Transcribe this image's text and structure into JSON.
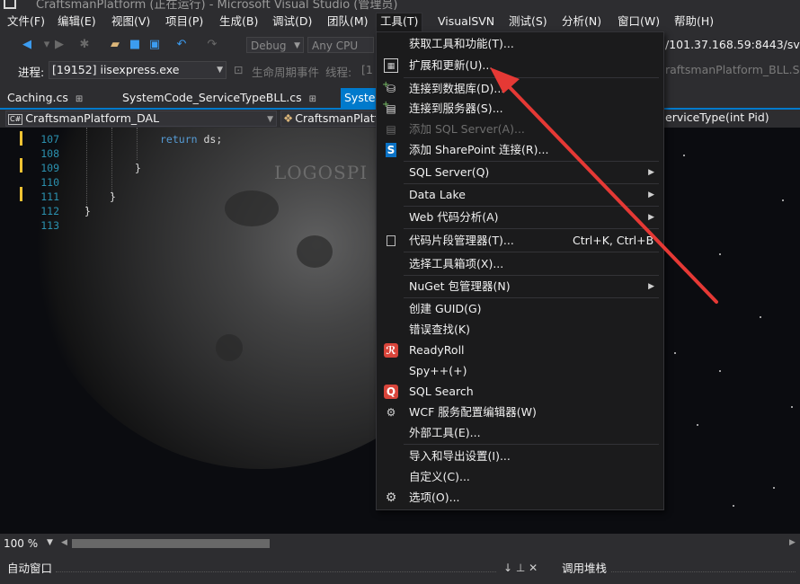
{
  "window": {
    "title": "CraftsmanPlatform (正在运行) - Microsoft Visual Studio (管理员)"
  },
  "menubar": {
    "items": [
      {
        "label": "文件(F)"
      },
      {
        "label": "编辑(E)"
      },
      {
        "label": "视图(V)"
      },
      {
        "label": "项目(P)"
      },
      {
        "label": "生成(B)"
      },
      {
        "label": "调试(D)"
      },
      {
        "label": "团队(M)"
      },
      {
        "label": "工具(T)"
      },
      {
        "label": "VisualSVN"
      },
      {
        "label": "测试(S)"
      },
      {
        "label": "分析(N)"
      },
      {
        "label": "窗口(W)"
      },
      {
        "label": "帮助(H)"
      }
    ]
  },
  "toolbar": {
    "config": "Debug",
    "platform": "Any CPU",
    "url_fragment": "/101.37.168.59:8443/svn/C"
  },
  "debug_toolbar": {
    "process_label": "进程:",
    "process_value": "[19152] iisexpress.exe",
    "lifecycle_label": "生命周期事件",
    "thread_label": "线程:",
    "thread_value": "[1",
    "right_fragment": "raftsmanPlatform_BLL.Syste"
  },
  "tabs": [
    {
      "label": "Caching.cs",
      "pin": "ꝋ"
    },
    {
      "label": "SystemCode_ServiceTypeBLL.cs",
      "pin": "ꝋ"
    },
    {
      "label": "System"
    }
  ],
  "navbar": {
    "project": "CraftsmanPlatform_DAL",
    "project_icon": "C#",
    "type": "CraftsmanPlatfo",
    "member": "erviceType(int Pid)"
  },
  "editor": {
    "watermark": "LOGOSPI",
    "lines": [
      {
        "num": "107",
        "code": "return ds;"
      },
      {
        "num": "108",
        "code": ""
      },
      {
        "num": "109",
        "code": "}"
      },
      {
        "num": "110",
        "code": ""
      },
      {
        "num": "111",
        "code": "}"
      },
      {
        "num": "112",
        "code": "}"
      },
      {
        "num": "113",
        "code": ""
      }
    ],
    "zoom": "100 %"
  },
  "panels": {
    "auto_window": "自动窗口",
    "call_stack": "调用堆栈",
    "pin_glyph": "↓ ⊥ ✕"
  },
  "tools_menu": {
    "items": [
      {
        "label": "获取工具和功能(T)...",
        "icon": ""
      },
      {
        "label": "扩展和更新(U)...",
        "icon": "extensions-icon"
      },
      {
        "label": "连接到数据库(D)...",
        "icon": "database-icon"
      },
      {
        "label": "连接到服务器(S)...",
        "icon": "server-icon"
      },
      {
        "label": "添加 SQL Server(A)...",
        "icon": "sql-server-icon",
        "disabled": true
      },
      {
        "label": "添加 SharePoint 连接(R)...",
        "icon": "sharepoint-icon"
      },
      {
        "label": "SQL Server(Q)",
        "submenu": true
      },
      {
        "label": "Data Lake",
        "submenu": true
      },
      {
        "label": "Web 代码分析(A)",
        "submenu": true
      },
      {
        "label": "代码片段管理器(T)...",
        "icon": "snippet-icon",
        "shortcut": "Ctrl+K, Ctrl+B"
      },
      {
        "label": "选择工具箱项(X)..."
      },
      {
        "label": "NuGet 包管理器(N)",
        "submenu": true
      },
      {
        "label": "创建 GUID(G)"
      },
      {
        "label": "错误查找(K)"
      },
      {
        "label": "ReadyRoll",
        "icon": "readyroll-icon"
      },
      {
        "label": "Spy++(+)"
      },
      {
        "label": "SQL Search",
        "icon": "sql-search-icon"
      },
      {
        "label": "WCF 服务配置编辑器(W)",
        "icon": "wcf-icon"
      },
      {
        "label": "外部工具(E)..."
      },
      {
        "label": "导入和导出设置(I)..."
      },
      {
        "label": "自定义(C)..."
      },
      {
        "label": "选项(O)...",
        "icon": "gear-icon"
      }
    ]
  },
  "colors": {
    "accent": "#007acc",
    "annotation_arrow": "#e53935",
    "background": "#2d2d30",
    "menu_bg": "#1b1b1c"
  }
}
